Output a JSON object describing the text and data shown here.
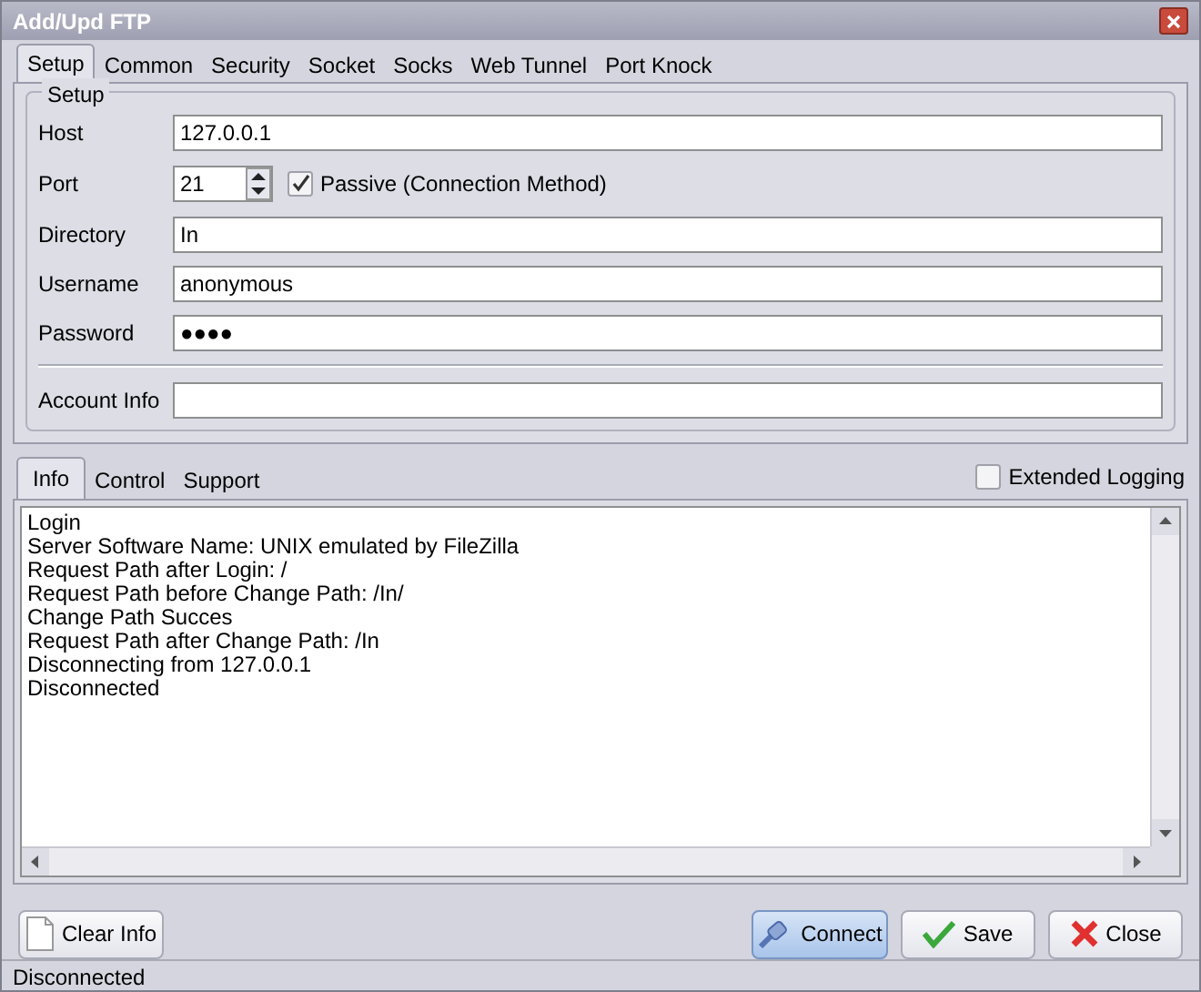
{
  "window": {
    "title": "Add/Upd FTP"
  },
  "tabs": [
    {
      "label": "Setup",
      "selected": true
    },
    {
      "label": "Common",
      "selected": false
    },
    {
      "label": "Security",
      "selected": false
    },
    {
      "label": "Socket",
      "selected": false
    },
    {
      "label": "Socks",
      "selected": false
    },
    {
      "label": "Web Tunnel",
      "selected": false
    },
    {
      "label": "Port Knock",
      "selected": false
    }
  ],
  "setup": {
    "title": "Setup",
    "host": {
      "label": "Host",
      "value": "127.0.0.1"
    },
    "port": {
      "label": "Port",
      "value": "21"
    },
    "passive": {
      "label": "Passive (Connection Method)",
      "checked": true
    },
    "directory": {
      "label": "Directory",
      "value": "In"
    },
    "username": {
      "label": "Username",
      "value": "anonymous"
    },
    "password": {
      "label": "Password",
      "value": "●●●●"
    },
    "account_info": {
      "label": "Account Info"
    }
  },
  "log_tabs": [
    {
      "label": "Info",
      "selected": true
    },
    {
      "label": "Control",
      "selected": false
    },
    {
      "label": "Support",
      "selected": false
    }
  ],
  "extended_logging": {
    "label": "Extended Logging",
    "checked": false
  },
  "log_lines": [
    "Login",
    "Server Software Name: UNIX emulated by FileZilla",
    "Request Path after Login: /",
    "Request Path before Change Path: /In/",
    "Change Path Succes",
    "Request Path after Change Path: /In",
    "Disconnecting from 127.0.0.1",
    "Disconnected"
  ],
  "buttons": [
    {
      "kind": "clear",
      "label": "Clear Info"
    },
    {
      "kind": "connect",
      "label": "Connect"
    },
    {
      "kind": "save",
      "label": "Save"
    },
    {
      "kind": "close",
      "label": "Close"
    }
  ],
  "status_bar": "Disconnected"
}
